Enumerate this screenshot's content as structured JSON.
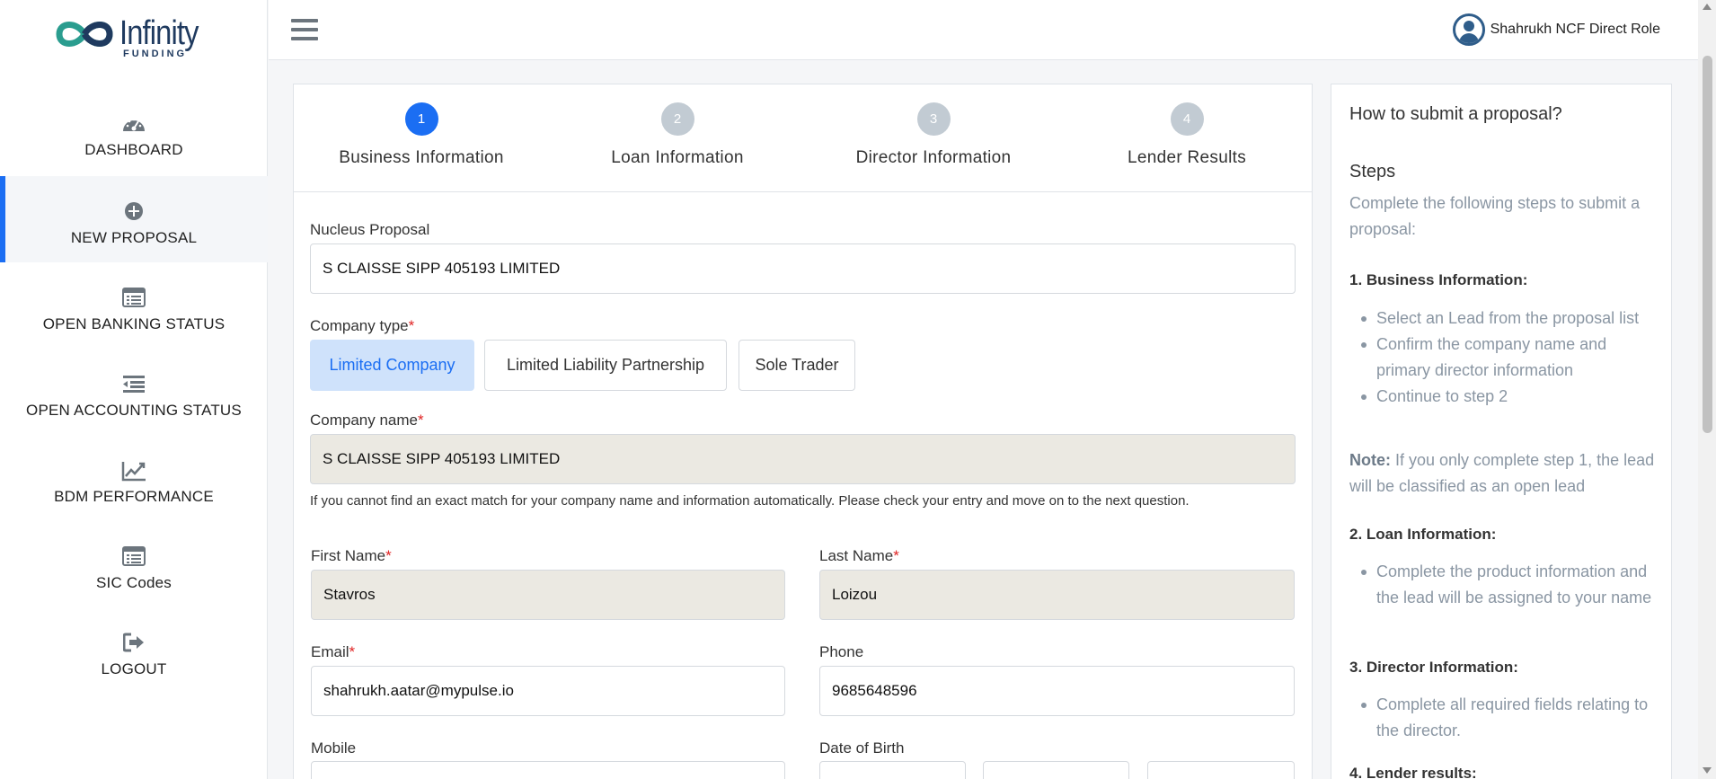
{
  "brand": {
    "name": "Infinity",
    "sub": "FUNDING"
  },
  "sidebar": {
    "items": [
      {
        "label": "DASHBOARD",
        "icon": "dashboard-gauge-icon"
      },
      {
        "label": "NEW PROPOSAL",
        "icon": "plus-circle-icon",
        "active": true
      },
      {
        "label": "OPEN BANKING STATUS",
        "icon": "list-card-icon"
      },
      {
        "label": "OPEN ACCOUNTING STATUS",
        "icon": "indent-list-icon"
      },
      {
        "label": "BDM PERFORMANCE",
        "icon": "line-chart-icon"
      },
      {
        "label": "SIC Codes",
        "icon": "list-card-icon"
      },
      {
        "label": "LOGOUT",
        "icon": "logout-icon"
      }
    ]
  },
  "header": {
    "user_name": "Shahrukh NCF Direct Role"
  },
  "stepper": {
    "steps": [
      {
        "number": "1",
        "label": "Business Information",
        "active": true
      },
      {
        "number": "2",
        "label": "Loan Information"
      },
      {
        "number": "3",
        "label": "Director Information"
      },
      {
        "number": "4",
        "label": "Lender Results"
      }
    ]
  },
  "form": {
    "nucleus_label": "Nucleus Proposal",
    "nucleus_value": "S CLAISSE SIPP 405193 LIMITED",
    "company_type_label": "Company type",
    "company_types": [
      "Limited Company",
      "Limited Liability Partnership",
      "Sole Trader"
    ],
    "company_type_selected": "Limited Company",
    "company_name_label": "Company name",
    "company_name_value": "S CLAISSE SIPP 405193 LIMITED",
    "help_text": "If you cannot find an exact match for your company name and information automatically. Please check your entry and move on to the next question.",
    "first_name_label": "First Name",
    "first_name_value": "Stavros",
    "last_name_label": "Last Name",
    "last_name_value": "Loizou",
    "email_label": "Email",
    "email_value": "shahrukh.aatar@mypulse.io",
    "phone_label": "Phone",
    "phone_value": "9685648596",
    "mobile_label": "Mobile",
    "mobile_value": "",
    "dob_label": "Date of Birth",
    "required_mark": "*"
  },
  "help": {
    "title": "How to submit a proposal?",
    "steps_heading": "Steps",
    "intro": "Complete the following steps to submit a proposal:",
    "s1_heading": "1. Business Information:",
    "s1_items": [
      "Select an Lead from the proposal list",
      "Confirm the company name and primary director information",
      "Continue to step 2"
    ],
    "note_label": "Note:",
    "note_text": " If you only complete step 1, the lead will be classified as an open lead",
    "s2_heading": "2. Loan Information:",
    "s2_items": [
      "Complete the product information and the lead will be assigned to your name"
    ],
    "s3_heading": "3. Director Information:",
    "s3_items": [
      "Complete all required fields relating to the director."
    ],
    "s4_heading": "4. Lender results:"
  },
  "colors": {
    "accent": "#1b6ef3",
    "disabled_input": "#ebe9e2",
    "selected_segment": "#cfe2fb"
  }
}
